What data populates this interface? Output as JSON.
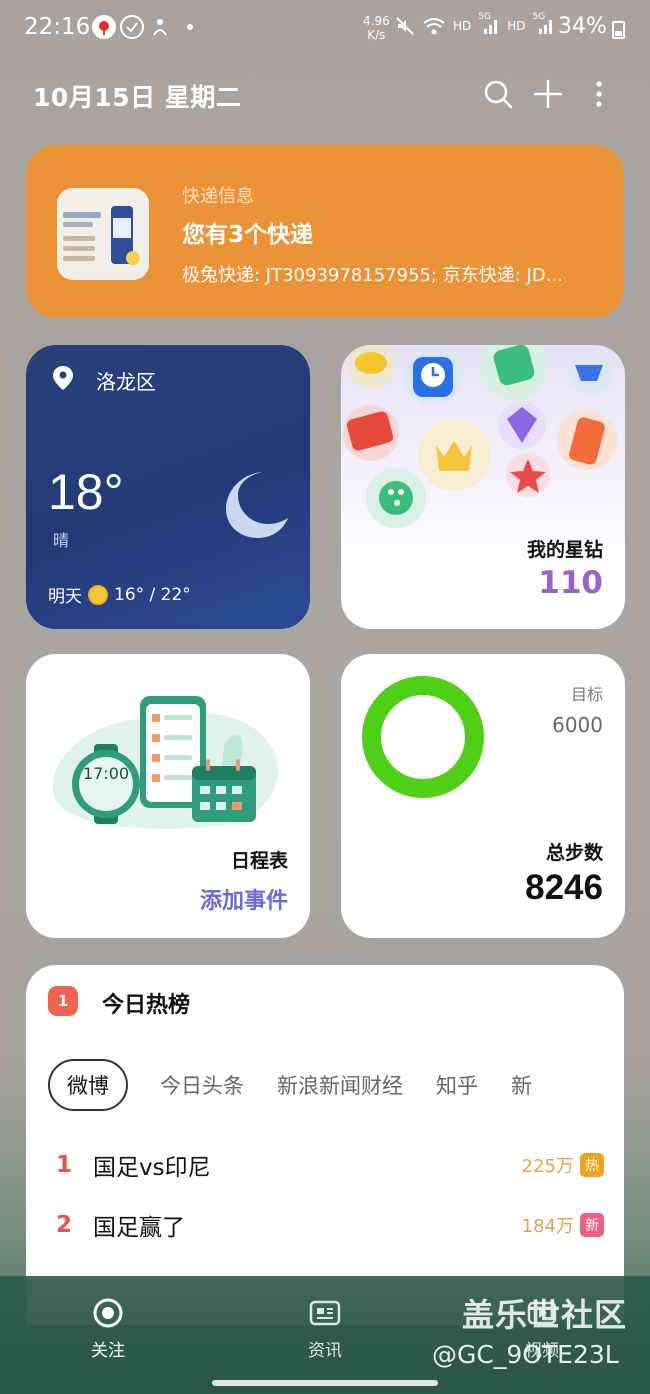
{
  "status_bar": {
    "time": "22:16",
    "speed_value": "4.96",
    "speed_unit": "K/s",
    "hd1": "HD",
    "sig1": "5G",
    "hd2": "HD",
    "sig2": "5G",
    "battery": "34%"
  },
  "header": {
    "date": "10月15日 星期二"
  },
  "delivery": {
    "label": "快递信息",
    "title": "您有3个快递",
    "detail": "极兔快递: JT3093978157955; 京东快递: JD..."
  },
  "weather": {
    "location": "洛龙区",
    "temperature": "18°",
    "condition": "晴",
    "tomorrow_label": "明天",
    "tomorrow_range": "16° / 22°"
  },
  "stars": {
    "label": "我的星钻",
    "count": "110"
  },
  "schedule": {
    "clock_text": "17:00",
    "label": "日程表",
    "add_label": "添加事件"
  },
  "steps": {
    "goal_label": "目标",
    "goal_value": "6000",
    "total_label": "总步数",
    "total_value": "8246",
    "progress": 1.0
  },
  "hot_list": {
    "icon_text": "1",
    "title": "今日热榜",
    "tabs": [
      "微博",
      "今日头条",
      "新浪新闻财经",
      "知乎",
      "新"
    ],
    "items": [
      {
        "rank": "1",
        "title": "国足vs印尼",
        "heat": "225万",
        "badge": "热",
        "badge_color": "#f2a21b"
      },
      {
        "rank": "2",
        "title": "国足赢了",
        "heat": "184万",
        "badge": "新",
        "badge_color": "#ee5f84"
      }
    ]
  },
  "nav": {
    "items": [
      {
        "label": "关注"
      },
      {
        "label": "资讯"
      },
      {
        "label": "视频"
      }
    ]
  },
  "watermark": {
    "line1": "盖乐世社区",
    "line2": "@GC_9OTE23L"
  },
  "colors": {
    "delivery_bg": "#eb9237",
    "weather_bg": "#27417c",
    "accent_purple": "#9b62c6",
    "link_purple": "#6f69d8",
    "ring_green": "#4fcf16",
    "rank_red": "#e0574a"
  }
}
